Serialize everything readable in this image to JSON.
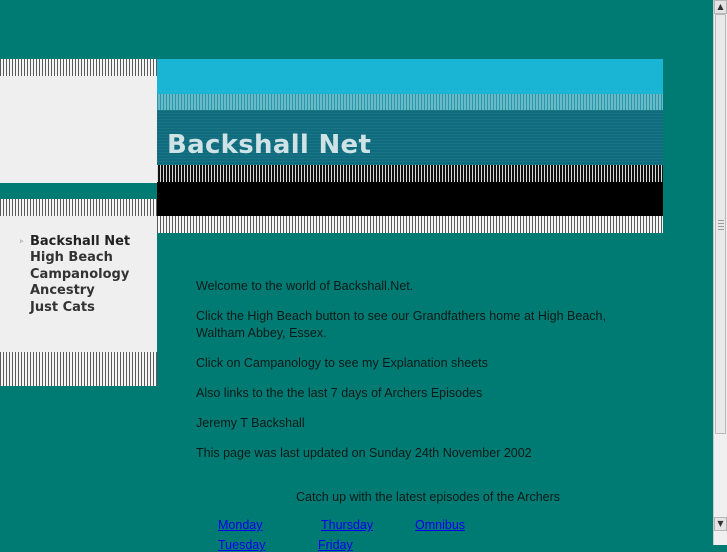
{
  "site": {
    "title": "Backshall Net"
  },
  "nav": {
    "marker": "▹",
    "items": [
      {
        "label": "Backshall Net"
      },
      {
        "label": "High Beach"
      },
      {
        "label": "Campanology"
      },
      {
        "label": "Ancestry"
      },
      {
        "label": "Just Cats"
      }
    ]
  },
  "content": {
    "paragraphs": [
      "Welcome to the world of Backshall.Net.",
      "Click the High Beach button to see our Grandfathers home at High Beach, Waltham Abbey, Essex.",
      "Click on Campanology to see my Explanation sheets",
      "Also links to the the last 7 days of Archers Episodes",
      "Jeremy T Backshall",
      "This page was last updated on Sunday 24th November 2002"
    ],
    "archers_heading": "Catch up with the latest episodes of the Archers",
    "episodes": [
      "Monday",
      "Thursday",
      "Omnibus",
      "Tuesday",
      "Friday"
    ]
  },
  "scrollbar": {
    "up_icon": "▲",
    "down_icon": "▼"
  },
  "colors": {
    "page_bg": "#007b73",
    "banner_cyan": "#1ab4d4",
    "banner_title_bg": "#0f6c7e",
    "link": "#0000ee"
  }
}
